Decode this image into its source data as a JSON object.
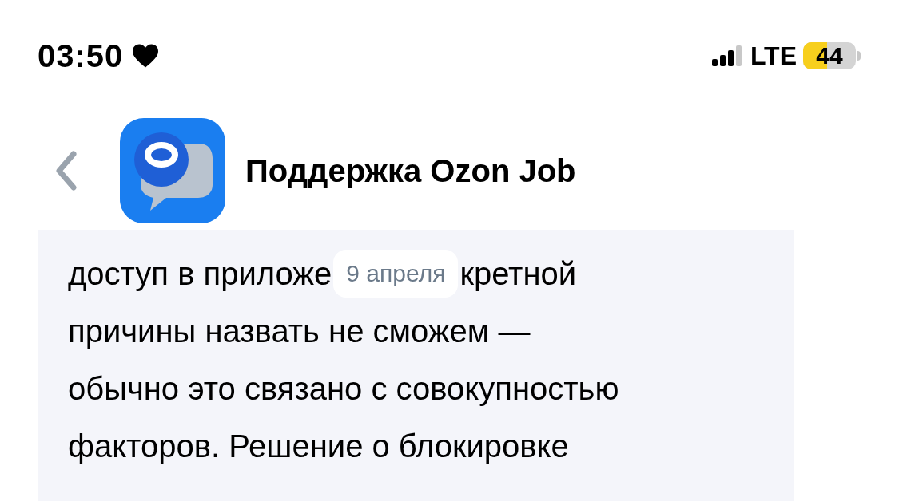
{
  "status_bar": {
    "time": "03:50",
    "network": "LTE",
    "battery": "44"
  },
  "header": {
    "title": "Поддержка Ozon Job"
  },
  "date_chip": "9 апреля",
  "message": {
    "covered_line": [
      "доступ в приложе",
      "кретной"
    ],
    "lines": [
      "причины назвать не сможем —",
      "обычно это связано с совокупностью",
      "факторов. Решение о блокировке"
    ]
  }
}
